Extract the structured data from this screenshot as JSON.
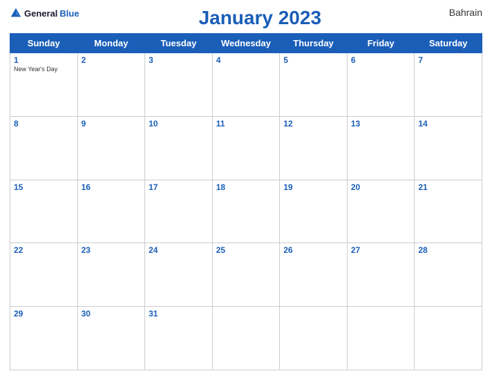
{
  "header": {
    "logo_general": "General",
    "logo_blue": "Blue",
    "title": "January 2023",
    "country": "Bahrain"
  },
  "days_of_week": [
    "Sunday",
    "Monday",
    "Tuesday",
    "Wednesday",
    "Thursday",
    "Friday",
    "Saturday"
  ],
  "weeks": [
    [
      {
        "day": "1",
        "holiday": "New Year's Day"
      },
      {
        "day": "2",
        "holiday": ""
      },
      {
        "day": "3",
        "holiday": ""
      },
      {
        "day": "4",
        "holiday": ""
      },
      {
        "day": "5",
        "holiday": ""
      },
      {
        "day": "6",
        "holiday": ""
      },
      {
        "day": "7",
        "holiday": ""
      }
    ],
    [
      {
        "day": "8",
        "holiday": ""
      },
      {
        "day": "9",
        "holiday": ""
      },
      {
        "day": "10",
        "holiday": ""
      },
      {
        "day": "11",
        "holiday": ""
      },
      {
        "day": "12",
        "holiday": ""
      },
      {
        "day": "13",
        "holiday": ""
      },
      {
        "day": "14",
        "holiday": ""
      }
    ],
    [
      {
        "day": "15",
        "holiday": ""
      },
      {
        "day": "16",
        "holiday": ""
      },
      {
        "day": "17",
        "holiday": ""
      },
      {
        "day": "18",
        "holiday": ""
      },
      {
        "day": "19",
        "holiday": ""
      },
      {
        "day": "20",
        "holiday": ""
      },
      {
        "day": "21",
        "holiday": ""
      }
    ],
    [
      {
        "day": "22",
        "holiday": ""
      },
      {
        "day": "23",
        "holiday": ""
      },
      {
        "day": "24",
        "holiday": ""
      },
      {
        "day": "25",
        "holiday": ""
      },
      {
        "day": "26",
        "holiday": ""
      },
      {
        "day": "27",
        "holiday": ""
      },
      {
        "day": "28",
        "holiday": ""
      }
    ],
    [
      {
        "day": "29",
        "holiday": ""
      },
      {
        "day": "30",
        "holiday": ""
      },
      {
        "day": "31",
        "holiday": ""
      },
      {
        "day": "",
        "holiday": ""
      },
      {
        "day": "",
        "holiday": ""
      },
      {
        "day": "",
        "holiday": ""
      },
      {
        "day": "",
        "holiday": ""
      }
    ]
  ],
  "accent_color": "#1a5eb8"
}
